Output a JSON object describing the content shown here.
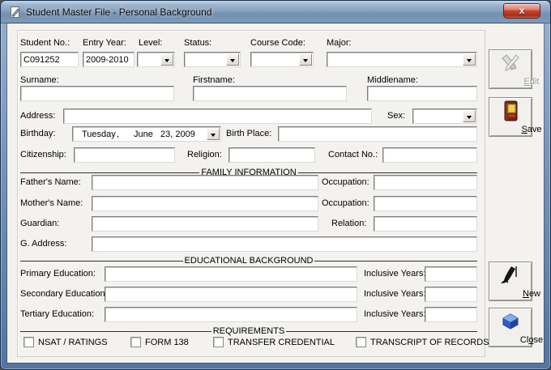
{
  "window": {
    "title": "Student Master File - Personal Background",
    "close_glyph": "x"
  },
  "top": {
    "student_no": {
      "label": "Student No.:",
      "value": "C091252"
    },
    "entry_year": {
      "label": "Entry Year:",
      "value": "2009-2010"
    },
    "level": {
      "label": "Level:",
      "value": ""
    },
    "status": {
      "label": "Status:",
      "value": ""
    },
    "course_code": {
      "label": "Course Code:",
      "value": ""
    },
    "major": {
      "label": "Major:",
      "value": ""
    }
  },
  "name": {
    "surname": {
      "label": "Surname:",
      "value": ""
    },
    "firstname": {
      "label": "Firstname:",
      "value": ""
    },
    "middlename": {
      "label": "Middlename:",
      "value": ""
    }
  },
  "personal": {
    "address": {
      "label": "Address:",
      "value": ""
    },
    "sex": {
      "label": "Sex:",
      "value": ""
    },
    "birthday": {
      "label": "Birthday:",
      "weekday": "Tuesday",
      "comma": ",",
      "month": "June",
      "day_year": "23, 2009"
    },
    "birth_place": {
      "label": "Birth Place:",
      "value": ""
    },
    "citizenship": {
      "label": "Citizenship:",
      "value": ""
    },
    "religion": {
      "label": "Religion:",
      "value": ""
    },
    "contact_no": {
      "label": "Contact No.:",
      "value": ""
    }
  },
  "family": {
    "title": "FAMILY INFORMATION",
    "fathers_name": {
      "label": "Father's Name:",
      "value": ""
    },
    "father_occupation": {
      "label": "Occupation:",
      "value": ""
    },
    "mothers_name": {
      "label": "Mother's Name:",
      "value": ""
    },
    "mother_occupation": {
      "label": "Occupation:",
      "value": ""
    },
    "guardian": {
      "label": "Guardian:",
      "value": ""
    },
    "relation": {
      "label": "Relation:",
      "value": ""
    },
    "g_address": {
      "label": "G. Address:",
      "value": ""
    }
  },
  "education": {
    "title": "EDUCATIONAL BACKGROUND",
    "inclusive_years_label": "Inclusive Years:",
    "primary": {
      "label": "Primary Education:",
      "value": "",
      "years": ""
    },
    "secondary": {
      "label": "Secondary Education:",
      "value": "",
      "years": ""
    },
    "tertiary": {
      "label": "Tertiary Education:",
      "value": "",
      "years": ""
    }
  },
  "requirements": {
    "title": "REQUIREMENTS",
    "items": [
      "NSAT / RATINGS",
      "FORM 138",
      "TRANSFER CREDENTIAL",
      "TRANSCRIPT OF RECORDS"
    ]
  },
  "buttons": {
    "edit": {
      "pre": "",
      "key": "E",
      "post": "dit"
    },
    "save": {
      "pre": "",
      "key": "S",
      "post": "ave"
    },
    "new": {
      "pre": "",
      "key": "N",
      "post": "ew"
    },
    "close": {
      "pre": "Cl",
      "key": "o",
      "post": "se"
    }
  },
  "colors": {
    "titlebar_blue": "#7E9AB8",
    "border_blue": "#53759F",
    "close_red": "#B02C17",
    "client_gray": "#F3F2EF"
  }
}
